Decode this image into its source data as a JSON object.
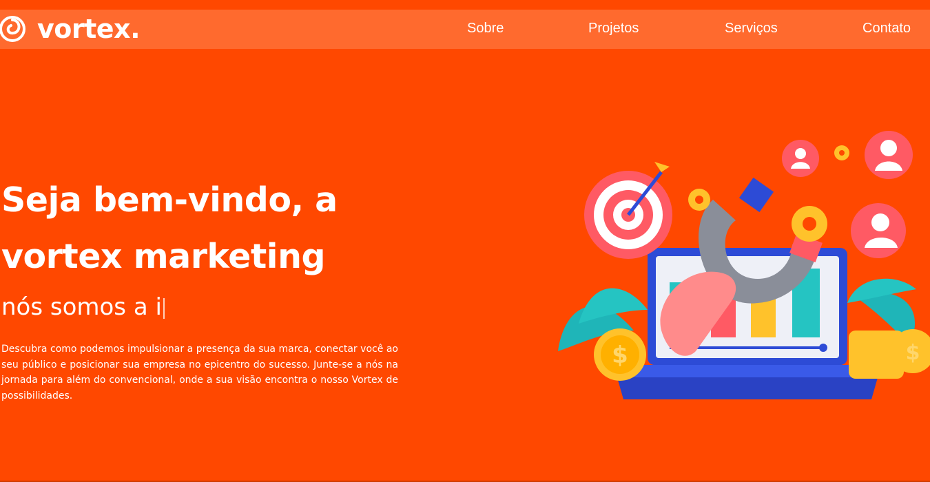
{
  "brand": {
    "name": "vortex.",
    "logo_icon": "swirl-icon"
  },
  "nav": {
    "items": [
      {
        "label": "Sobre"
      },
      {
        "label": "Projetos"
      },
      {
        "label": "Serviços"
      },
      {
        "label": "Contato"
      }
    ]
  },
  "hero": {
    "title_line1": "Seja bem-vindo, a",
    "title_line2": "vortex marketing",
    "typing_text": "nós somos a i",
    "description": "Descubra como podemos impulsionar a presença da sua marca, conectar você ao seu público e posicionar sua empresa no epicentro do sucesso. Junte-se a nós na jornada para além do convencional, onde a sua visão encontra o nosso Vortex de possibilidades."
  },
  "illustration": {
    "icons": [
      "target-icon",
      "magnet-icon",
      "laptop-icon",
      "bar-chart-icon",
      "gear-icon",
      "user-avatar-icon",
      "coin-icon",
      "plant-icon"
    ]
  },
  "colors": {
    "background": "#ff4800",
    "navbar": "#ff6a2e",
    "text": "#ffffff"
  }
}
